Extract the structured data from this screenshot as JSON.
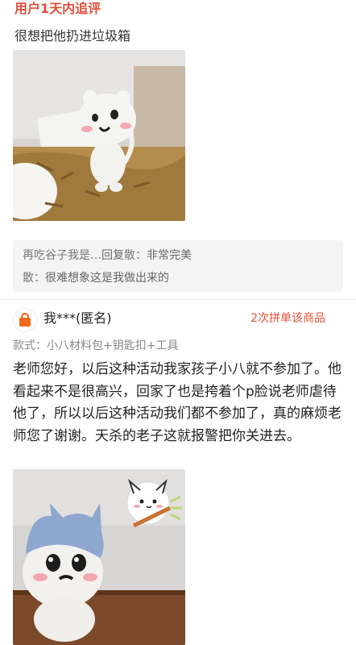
{
  "followup": {
    "title": "用户1天内追评",
    "text": "很想把他扔进垃圾箱"
  },
  "reply": {
    "line1_name": "再吃谷子我是…",
    "line1_action": "回复",
    "line1_user": "散：",
    "line1_text": "非常完美",
    "line2_user": "散：",
    "line2_text": "很难想象这是我做出来的"
  },
  "review": {
    "username": "我***(匿名)",
    "badge": "2次拼单该商品",
    "variant": "款式：小八材料包+钥匙扣+工具",
    "text": "老师您好，以后这种活动我家孩子小八就不参加了。他看起来不是很高兴，回家了也是挎着个p脸说老师虐待他了，所以以后这种活动我们都不参加了，真的麻烦老师您了谢谢。天杀的老子这就报警把你关进去。"
  },
  "colors": {
    "accent": "#e0513a",
    "reply_bg": "#f4f4f4",
    "avatar_icon": "#f26a1b"
  },
  "icons": {
    "avatar": "shopping-bag-icon"
  }
}
